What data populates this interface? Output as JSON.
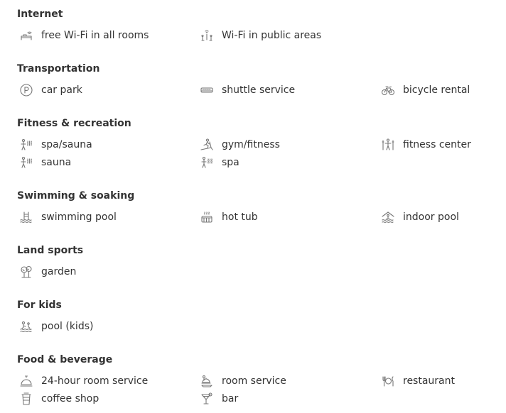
{
  "sections": [
    {
      "title": "Internet",
      "items": [
        {
          "label": "free Wi-Fi in all rooms",
          "icon": "wifi-bed-icon"
        },
        {
          "label": "Wi-Fi in public areas",
          "icon": "wifi-people-icon"
        }
      ]
    },
    {
      "title": "Transportation",
      "items": [
        {
          "label": "car park",
          "icon": "parking-icon"
        },
        {
          "label": "shuttle service",
          "icon": "shuttle-icon"
        },
        {
          "label": "bicycle rental",
          "icon": "bicycle-icon"
        }
      ]
    },
    {
      "title": "Fitness & recreation",
      "items": [
        {
          "label": "spa/sauna",
          "icon": "sauna-icon"
        },
        {
          "label": "gym/fitness",
          "icon": "treadmill-icon"
        },
        {
          "label": "fitness center",
          "icon": "fitness-center-icon"
        },
        {
          "label": "sauna",
          "icon": "sauna-icon"
        },
        {
          "label": "spa",
          "icon": "spa-icon"
        }
      ]
    },
    {
      "title": "Swimming & soaking",
      "items": [
        {
          "label": "swimming pool",
          "icon": "pool-icon"
        },
        {
          "label": "hot tub",
          "icon": "hot-tub-icon"
        },
        {
          "label": "indoor pool",
          "icon": "indoor-pool-icon"
        }
      ]
    },
    {
      "title": "Land sports",
      "items": [
        {
          "label": "garden",
          "icon": "garden-icon"
        }
      ]
    },
    {
      "title": "For kids",
      "items": [
        {
          "label": "pool (kids)",
          "icon": "kids-pool-icon"
        }
      ]
    },
    {
      "title": "Food & beverage",
      "items": [
        {
          "label": "24-hour room service",
          "icon": "cloche-icon"
        },
        {
          "label": "room service",
          "icon": "room-service-icon"
        },
        {
          "label": "restaurant",
          "icon": "restaurant-icon"
        },
        {
          "label": "coffee shop",
          "icon": "coffee-icon"
        },
        {
          "label": "bar",
          "icon": "cocktail-icon"
        }
      ]
    }
  ],
  "colors": {
    "text": "#333333",
    "icon": "#777777",
    "background": "#ffffff"
  }
}
